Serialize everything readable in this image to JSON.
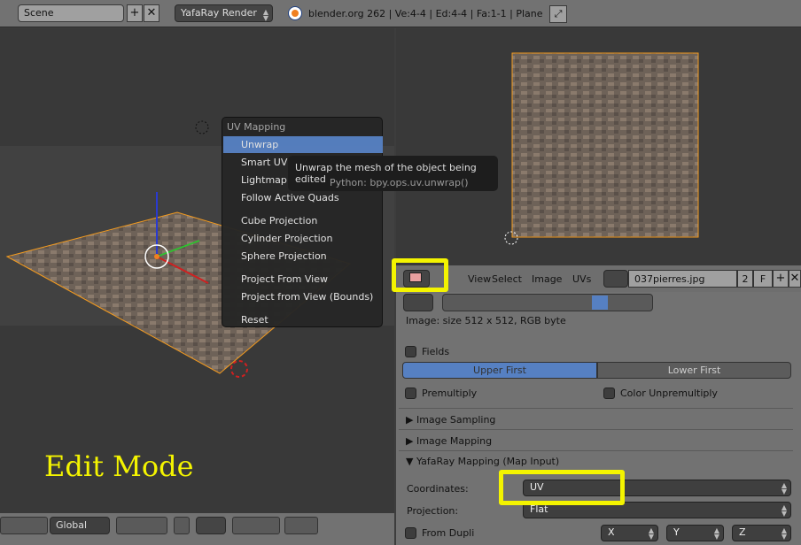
{
  "topbar": {
    "scene": "Scene",
    "renderer": "YafaRay Render",
    "info": "blender.org 262 | Ve:4-4 | Ed:4-4 | Fa:1-1 | Plane"
  },
  "menu": {
    "title": "UV Mapping",
    "items": [
      "Unwrap",
      "Smart UV Project",
      "Lightmap Pack",
      "Follow Active Quads",
      "Cube Projection",
      "Cylinder Projection",
      "Sphere Projection",
      "Project From View",
      "Project from View (Bounds)",
      "Reset"
    ],
    "active": "Unwrap"
  },
  "tooltip": {
    "text": "Unwrap the mesh of the object being edited",
    "python": "Python: bpy.ops.uv.unwrap()"
  },
  "viewport": {
    "overlay_text": "Edit Mode",
    "transform_orientation": "Global"
  },
  "uv_header": {
    "menus": [
      "View",
      "Select",
      "Image",
      "UVs"
    ],
    "image_name": "037pierres.jpg",
    "users": "2",
    "fake": "F"
  },
  "props": {
    "image_info": "Image: size 512 x 512, RGB byte",
    "fields": "Fields",
    "upper_first": "Upper First",
    "lower_first": "Lower First",
    "premultiply": "Premultiply",
    "color_unpremultiply": "Color Unpremultiply",
    "panels": [
      "Image Sampling",
      "Image Mapping",
      "YafaRay Mapping (Map Input)"
    ],
    "coordinates_label": "Coordinates:",
    "coordinates": "UV",
    "projection_label": "Projection:",
    "projection": "Flat",
    "from_dupli": "From Dupli",
    "x": "X",
    "y": "Y",
    "z": "Z"
  },
  "colors": {
    "highlight": "#f4f400",
    "accent": "#5680c2",
    "edge": "#f29a1f"
  }
}
